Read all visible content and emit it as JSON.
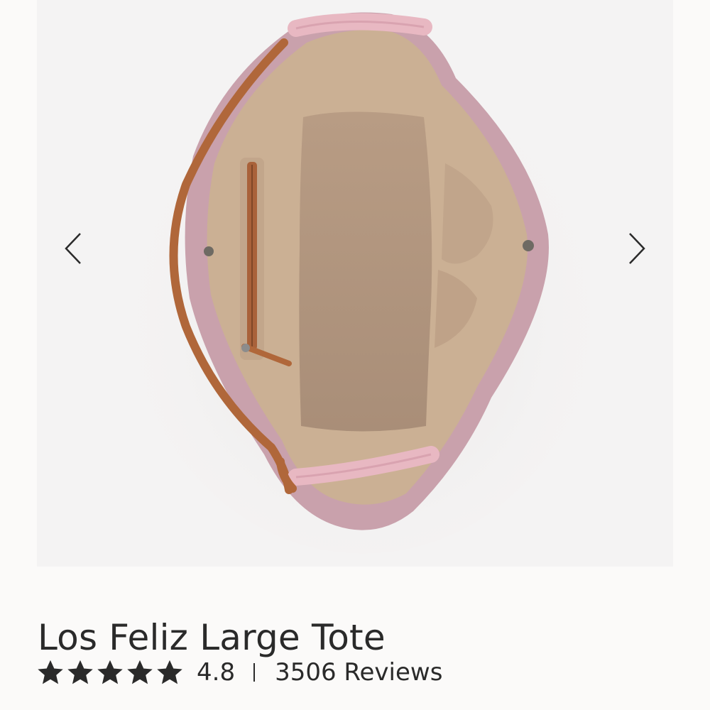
{
  "product": {
    "name": "Los Feliz Large Tote",
    "rating": "4.8",
    "rating_fraction": 0.96,
    "stars_filled": 5,
    "stars_total": 5,
    "separator": "|",
    "reviews_label": "3506 Reviews"
  },
  "gallery": {
    "prev_icon": "chevron-left-icon",
    "next_icon": "chevron-right-icon"
  },
  "colors": {
    "text": "#2a2a2a",
    "gallery_bg": "#f4f3f3",
    "bag_pink": "#c9a1ac",
    "lining": "#c9ad92",
    "leather_trim": "#b0673a"
  }
}
